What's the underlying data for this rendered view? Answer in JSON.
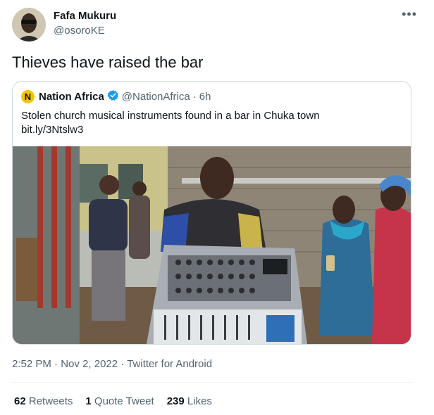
{
  "author": {
    "name": "Fafa Mukuru",
    "handle": "@osoroKE"
  },
  "tweet": {
    "text": "Thieves have raised the bar"
  },
  "quote": {
    "logo_letter": "N",
    "name": "Nation Africa",
    "handle": "@NationAfrica",
    "separator": "·",
    "time": "6h",
    "text": "Stolen church musical instruments found in a bar in Chuka town",
    "link": "bit.ly/3Ntslw3"
  },
  "meta": {
    "time": "2:52 PM",
    "date": "Nov 2, 2022",
    "separator": "·",
    "source": "Twitter for Android"
  },
  "stats": {
    "retweets_count": "62",
    "retweets_label": "Retweets",
    "quotes_count": "1",
    "quotes_label": "Quote Tweet",
    "likes_count": "239",
    "likes_label": "Likes"
  },
  "icons": {
    "more": "more-icon",
    "verified": "verified-badge-icon"
  },
  "colors": {
    "verified": "#1d9bf0",
    "secondary_text": "#536471",
    "border": "#cfd9de"
  }
}
